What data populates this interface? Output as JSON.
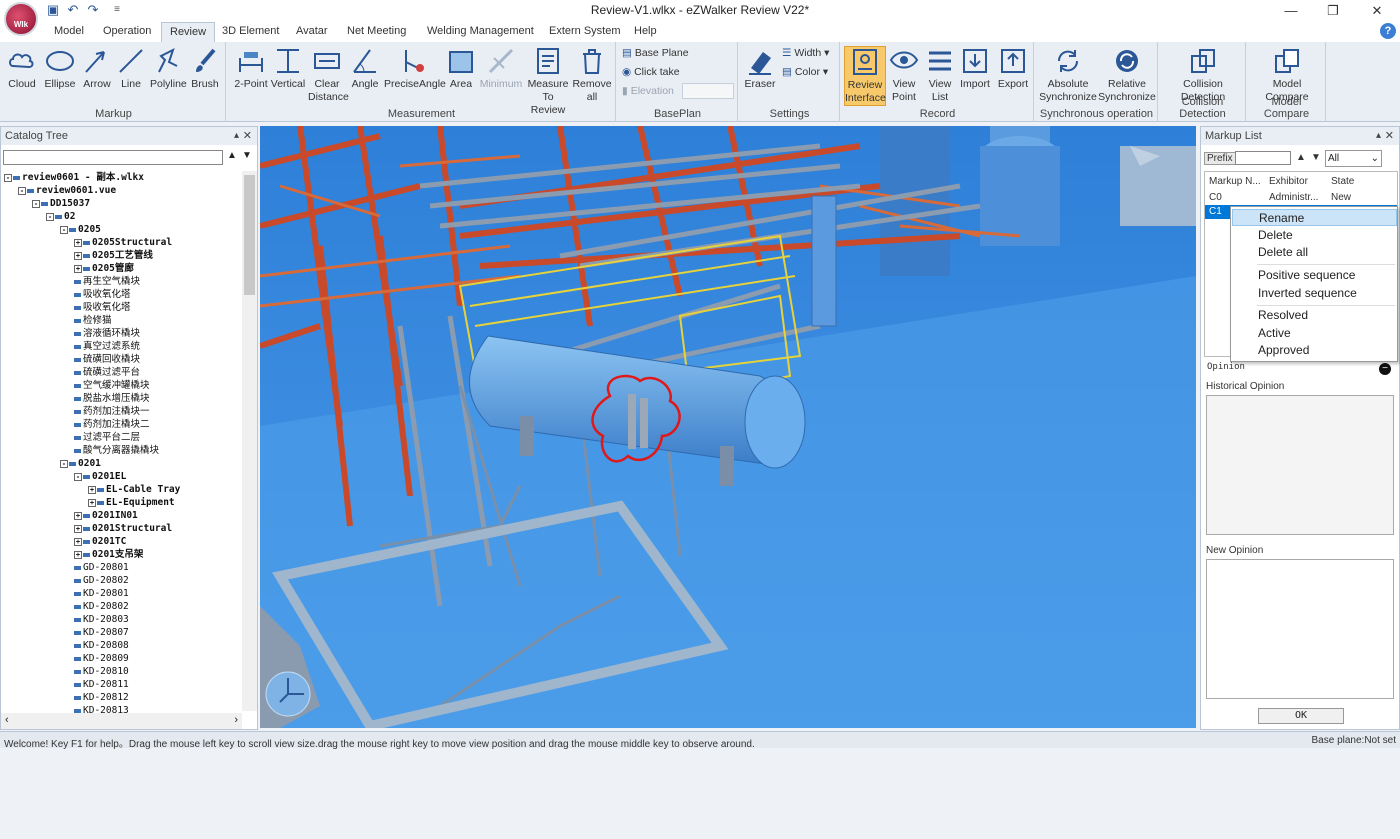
{
  "app": {
    "title": "Review-V1.wlkx - eZWalker Review V22*",
    "logo_text": "WIk",
    "menu_glyph": "≡"
  },
  "tabs": [
    "Model",
    "Operation",
    "Review",
    "3D Element",
    "Avatar",
    "Net Meeting",
    "Welding Management",
    "Extern System",
    "Help"
  ],
  "ribbon": {
    "markup": {
      "label": "Markup",
      "items": [
        "Cloud",
        "Ellipse",
        "Arrow",
        "Line",
        "Polyline",
        "Brush"
      ]
    },
    "measurement": {
      "label": "Measurement",
      "items": [
        "2-Point",
        "Vertical",
        "Clear Distance",
        "Angle",
        "PreciseAngle",
        "Area",
        "Minimum",
        "Measure To Review",
        "Remove all"
      ]
    },
    "baseplan": {
      "label": "BasePlan",
      "base_plane": "Base Plane",
      "click_take": "Click take",
      "elevation": "Elevation"
    },
    "settings": {
      "label": "Settings",
      "eraser": "Eraser",
      "width": "Width",
      "color": "Color"
    },
    "record": {
      "label": "Record",
      "items": [
        "Review Interface",
        "View Point",
        "View List",
        "Import",
        "Export"
      ]
    },
    "sync": {
      "label": "Synchronous operation",
      "items": [
        "Absolute Synchronize",
        "Relative Synchronize"
      ]
    },
    "collision": {
      "label": "Collision Detection",
      "item": "Collision Detection"
    },
    "compare": {
      "label": "Model Compare",
      "item": "Model Compare"
    }
  },
  "catalog": {
    "title": "Catalog Tree",
    "items": [
      {
        "t": "review0601 - 副本.wlkx",
        "lvl": 0,
        "box": "-",
        "bold": true
      },
      {
        "t": "review0601.vue",
        "lvl": 1,
        "box": "-",
        "bold": true
      },
      {
        "t": "DD15037",
        "lvl": 2,
        "box": "-",
        "bold": true
      },
      {
        "t": "02",
        "lvl": 3,
        "box": "-",
        "bold": true
      },
      {
        "t": "0205",
        "lvl": 4,
        "box": "-",
        "bold": true
      },
      {
        "t": "0205Structural",
        "lvl": 5,
        "box": "+",
        "bold": true
      },
      {
        "t": "0205工艺管线",
        "lvl": 5,
        "box": "+",
        "bold": true
      },
      {
        "t": "0205管廊",
        "lvl": 5,
        "box": "+",
        "bold": true
      },
      {
        "t": "再生空气橇块",
        "lvl": 5
      },
      {
        "t": "吸收氧化塔",
        "lvl": 5
      },
      {
        "t": "吸收氧化塔",
        "lvl": 5
      },
      {
        "t": "检修猫",
        "lvl": 5
      },
      {
        "t": "溶液循环橇块",
        "lvl": 5
      },
      {
        "t": "真空过滤系统",
        "lvl": 5
      },
      {
        "t": "硫磺回收橇块",
        "lvl": 5
      },
      {
        "t": "硫磺过滤平台",
        "lvl": 5
      },
      {
        "t": "空气缓冲罐橇块",
        "lvl": 5
      },
      {
        "t": "脱盐水增压橇块",
        "lvl": 5
      },
      {
        "t": "药剂加注橇块一",
        "lvl": 5
      },
      {
        "t": "药剂加注橇块二",
        "lvl": 5
      },
      {
        "t": "过滤平台二层",
        "lvl": 5
      },
      {
        "t": "酸气分离器撬橇块",
        "lvl": 5
      },
      {
        "t": "0201",
        "lvl": 4,
        "box": "-",
        "bold": true
      },
      {
        "t": "0201EL",
        "lvl": 5,
        "box": "-",
        "bold": true
      },
      {
        "t": "EL-Cable Tray",
        "lvl": 6,
        "box": "+",
        "bold": true
      },
      {
        "t": "EL-Equipment",
        "lvl": 6,
        "box": "+",
        "bold": true
      },
      {
        "t": "0201IN01",
        "lvl": 5,
        "box": "+",
        "bold": true
      },
      {
        "t": "0201Structural",
        "lvl": 5,
        "box": "+",
        "bold": true
      },
      {
        "t": "0201TC",
        "lvl": 5,
        "box": "+",
        "bold": true
      },
      {
        "t": "0201支吊架",
        "lvl": 5,
        "box": "+",
        "bold": true
      },
      {
        "t": "GD-20801",
        "lvl": 5
      },
      {
        "t": "GD-20802",
        "lvl": 5
      },
      {
        "t": "KD-20801",
        "lvl": 5
      },
      {
        "t": "KD-20802",
        "lvl": 5
      },
      {
        "t": "KD-20803",
        "lvl": 5
      },
      {
        "t": "KD-20807",
        "lvl": 5
      },
      {
        "t": "KD-20808",
        "lvl": 5
      },
      {
        "t": "KD-20809",
        "lvl": 5
      },
      {
        "t": "KD-20810",
        "lvl": 5
      },
      {
        "t": "KD-20811",
        "lvl": 5
      },
      {
        "t": "KD-20812",
        "lvl": 5
      },
      {
        "t": "KD-20813",
        "lvl": 5
      }
    ]
  },
  "markup_list": {
    "title": "Markup List",
    "prefix_label": "Prefix",
    "filter": "All",
    "columns": [
      "Markup N...",
      "Exhibitor",
      "State"
    ],
    "rows": [
      [
        "C0",
        "Administr...",
        "New"
      ],
      [
        "C1",
        "",
        ""
      ]
    ],
    "opinion_label": "Opinion",
    "historical": "Historical Opinion",
    "new_opinion": "New Opinion",
    "ok": "OK"
  },
  "context_menu": [
    "Rename",
    "Delete",
    "Delete all",
    "Positive sequence",
    "Inverted sequence",
    "Resolved",
    "Active",
    "Approved"
  ],
  "status": {
    "left": "Welcome! Key F1 for help。Drag the mouse left key to scroll view size.drag the mouse right key to move view position and drag the mouse middle key to observe around.",
    "right": "Base plane:Not set"
  }
}
